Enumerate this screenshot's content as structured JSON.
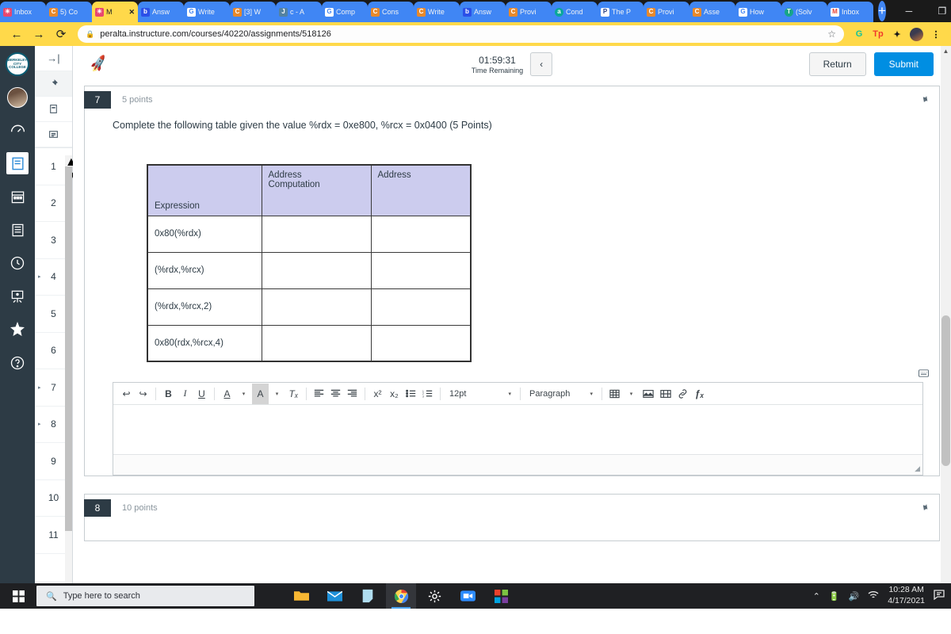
{
  "browser": {
    "tabs": [
      {
        "label": "Inbox",
        "favicon": "canvas-icon",
        "color": "#e8476f",
        "active": false
      },
      {
        "label": "5) Co",
        "favicon": "canvas-c-icon",
        "color": "#e8892b",
        "active": false
      },
      {
        "label": "M",
        "favicon": "canvas-icon",
        "color": "#e8476f",
        "active": true,
        "close": "✕"
      },
      {
        "label": "Answ",
        "favicon": "brainly-b-icon",
        "color": "#2b50e8",
        "active": false
      },
      {
        "label": "Write",
        "favicon": "google-g-icon",
        "color": "#ffffff",
        "active": false
      },
      {
        "label": "[3] W",
        "favicon": "canvas-c-icon",
        "color": "#e8892b",
        "active": false
      },
      {
        "label": "c - A",
        "favicon": "java-icon",
        "color": "#5382a1",
        "active": false
      },
      {
        "label": "Comp",
        "favicon": "google-g-icon",
        "color": "#ffffff",
        "active": false
      },
      {
        "label": "Cons",
        "favicon": "canvas-c-icon",
        "color": "#e8892b",
        "active": false
      },
      {
        "label": "Write",
        "favicon": "canvas-c-icon",
        "color": "#e8892b",
        "active": false
      },
      {
        "label": "Answ",
        "favicon": "brainly-b-icon",
        "color": "#2b50e8",
        "active": false
      },
      {
        "label": "Provi",
        "favicon": "canvas-c-icon",
        "color": "#e8892b",
        "active": false
      },
      {
        "label": "Cond",
        "favicon": "arm-icon",
        "color": "#0aa79a",
        "active": false
      },
      {
        "label": "The P",
        "favicon": "paypal-p-icon",
        "color": "#ffffff",
        "active": false
      },
      {
        "label": "Provi",
        "favicon": "canvas-c-icon",
        "color": "#e8892b",
        "active": false
      },
      {
        "label": "Asse",
        "favicon": "canvas-c-icon",
        "color": "#e8892b",
        "active": false
      },
      {
        "label": "How",
        "favicon": "google-g-icon",
        "color": "#ffffff",
        "active": false
      },
      {
        "label": "(Solv",
        "favicon": "transtutors-icon",
        "color": "#17a589",
        "active": false
      },
      {
        "label": "Inbox",
        "favicon": "gmail-m-icon",
        "color": "#ffffff",
        "active": false
      }
    ],
    "new_tab_label": "+",
    "window_controls": {
      "minimize": "─",
      "maximize": "❐",
      "close": "✕"
    },
    "nav": {
      "back": "←",
      "forward": "→",
      "reload": "⟳"
    },
    "url": "peralta.instructure.com/courses/40220/assignments/518126",
    "lock_icon": "lock-icon",
    "bookmark_icon": "star-icon",
    "extensions": [
      {
        "name": "grammarly-extension-icon",
        "glyph": "G",
        "color": "#15c39a"
      },
      {
        "name": "teacherspayteachers-extension-icon",
        "glyph": "Tp",
        "color": "#f0392b"
      },
      {
        "name": "puzzle-extensions-icon",
        "glyph": "❖",
        "color": "#1a1a1a"
      }
    ],
    "profile_icon": "profile-avatar",
    "menu_icon": "kebab-menu-icon"
  },
  "canvas_nav": [
    {
      "name": "berkeley-city-college-logo",
      "label": "BERKELEY CITY COLLEGE"
    },
    {
      "name": "account-avatar",
      "label": ""
    },
    {
      "name": "dashboard-icon",
      "glyph": "◔"
    },
    {
      "name": "courses-icon",
      "glyph": "☰"
    },
    {
      "name": "calendar-icon",
      "glyph": "▦"
    },
    {
      "name": "inbox-icon",
      "glyph": "✉"
    },
    {
      "name": "history-icon",
      "glyph": "◴"
    },
    {
      "name": "studio-icon",
      "glyph": "⬚"
    },
    {
      "name": "star-badge-icon",
      "glyph": "✦"
    },
    {
      "name": "help-icon",
      "glyph": "?"
    }
  ],
  "question_nav": {
    "tools": [
      {
        "name": "collapse-panel-icon",
        "glyph": "→|"
      },
      {
        "name": "pin-panel-icon",
        "glyph": "✐"
      },
      {
        "name": "question-list-icon",
        "glyph": "⬜"
      },
      {
        "name": "question-outline-icon",
        "glyph": "☰"
      }
    ],
    "numbers": [
      {
        "n": "1",
        "flagged": false
      },
      {
        "n": "2",
        "flagged": false
      },
      {
        "n": "3",
        "flagged": false
      },
      {
        "n": "4",
        "flagged": true
      },
      {
        "n": "5",
        "flagged": false
      },
      {
        "n": "6",
        "flagged": false
      },
      {
        "n": "7",
        "flagged": true
      },
      {
        "n": "8",
        "flagged": true
      },
      {
        "n": "9",
        "flagged": false
      },
      {
        "n": "10",
        "flagged": false
      },
      {
        "n": "11",
        "flagged": false
      }
    ],
    "bottom_icon": "expand-panel-icon",
    "bottom_glyph": "→|"
  },
  "exam_header": {
    "rocket_icon": "rocket-icon",
    "timer_value": "01:59:31",
    "timer_label": "Time Remaining",
    "collapse_glyph": "‹",
    "return_label": "Return",
    "submit_label": "Submit"
  },
  "question_7": {
    "number": "7",
    "points": "5 points",
    "flag_icon": "flag-pin-icon",
    "prompt": "Complete the following table given the value %rdx = 0xe800, %rcx = 0x0400  (5 Points)",
    "table": {
      "headers": [
        "Expression",
        "Address Computation",
        "Address"
      ],
      "rows": [
        [
          "0x80(%rdx)",
          "",
          ""
        ],
        [
          "(%rdx,%rcx)",
          "",
          ""
        ],
        [
          "(%rdx,%rcx,2)",
          "",
          ""
        ],
        [
          "0x80(rdx,%rcx,4)",
          "",
          ""
        ]
      ],
      "header_bg": "#ccccee"
    },
    "keyboard_icon": "keyboard-shortcuts-icon"
  },
  "rce_toolbar": {
    "buttons": [
      {
        "name": "undo-icon",
        "glyph": "↩"
      },
      {
        "name": "redo-icon",
        "glyph": "↪"
      },
      {
        "name": "bold-icon",
        "glyph": "B"
      },
      {
        "name": "italic-icon",
        "glyph": "I"
      },
      {
        "name": "underline-icon",
        "glyph": "U"
      },
      {
        "name": "text-color-icon",
        "glyph": "A"
      },
      {
        "name": "text-color-caret-icon",
        "glyph": "▾"
      },
      {
        "name": "highlight-color-icon",
        "glyph": "A"
      },
      {
        "name": "highlight-color-caret-icon",
        "glyph": "▾"
      },
      {
        "name": "clear-formatting-icon",
        "glyph": "Tₓ"
      },
      {
        "name": "align-left-icon",
        "glyph": "☰"
      },
      {
        "name": "align-center-icon",
        "glyph": "☰"
      },
      {
        "name": "align-right-icon",
        "glyph": "☰"
      },
      {
        "name": "superscript-icon",
        "glyph": "x²"
      },
      {
        "name": "subscript-icon",
        "glyph": "x₂"
      },
      {
        "name": "bulleted-list-icon",
        "glyph": "☰"
      },
      {
        "name": "numbered-list-icon",
        "glyph": "☰"
      }
    ],
    "font_size": "12pt",
    "paragraph_style": "Paragraph",
    "right_buttons": [
      {
        "name": "insert-table-icon",
        "glyph": "▦"
      },
      {
        "name": "table-caret-icon",
        "glyph": "▾"
      },
      {
        "name": "insert-image-icon",
        "glyph": "Ὓc"
      },
      {
        "name": "insert-media-icon",
        "glyph": "⬚"
      },
      {
        "name": "insert-link-icon",
        "glyph": "ὑ7"
      },
      {
        "name": "insert-equation-icon",
        "glyph": "ƒₓ"
      }
    ],
    "editor_value": "",
    "resize_glyph": "◢"
  },
  "question_8": {
    "number": "8",
    "points": "10 points",
    "flag_icon": "flag-pin-icon"
  },
  "taskbar": {
    "start_glyph": "⊞",
    "search_placeholder": "Type here to search",
    "search_icon": "magnifier-icon",
    "apps": [
      {
        "name": "file-explorer-icon",
        "glyph": "὜0",
        "color": "#f7b733",
        "active": false
      },
      {
        "name": "mail-icon",
        "glyph": "✉",
        "color": "#1e90d8",
        "active": false
      },
      {
        "name": "sticky-notes-icon",
        "glyph": "◧",
        "color": "#8fd4ef",
        "active": false
      },
      {
        "name": "chrome-icon",
        "glyph": "◉",
        "color": "#4285f4",
        "active": true
      },
      {
        "name": "settings-gear-icon",
        "glyph": "⚙",
        "color": "#ffffff",
        "active": false
      },
      {
        "name": "zoom-icon",
        "glyph": "▣",
        "color": "#2d8cff",
        "active": false
      },
      {
        "name": "microsoft-store-icon",
        "glyph": "⊞",
        "color": "#e8412c",
        "active": false
      }
    ],
    "tray": [
      {
        "name": "show-hidden-icons-icon",
        "glyph": "˄"
      },
      {
        "name": "battery-icon",
        "glyph": "▮"
      },
      {
        "name": "volume-icon",
        "glyph": "ὐ9"
      },
      {
        "name": "wifi-icon",
        "glyph": "◠"
      }
    ],
    "clock_time": "10:28 AM",
    "clock_date": "4/17/2021",
    "action_center_icon": "action-center-icon",
    "action_center_glyph": "὞a"
  }
}
